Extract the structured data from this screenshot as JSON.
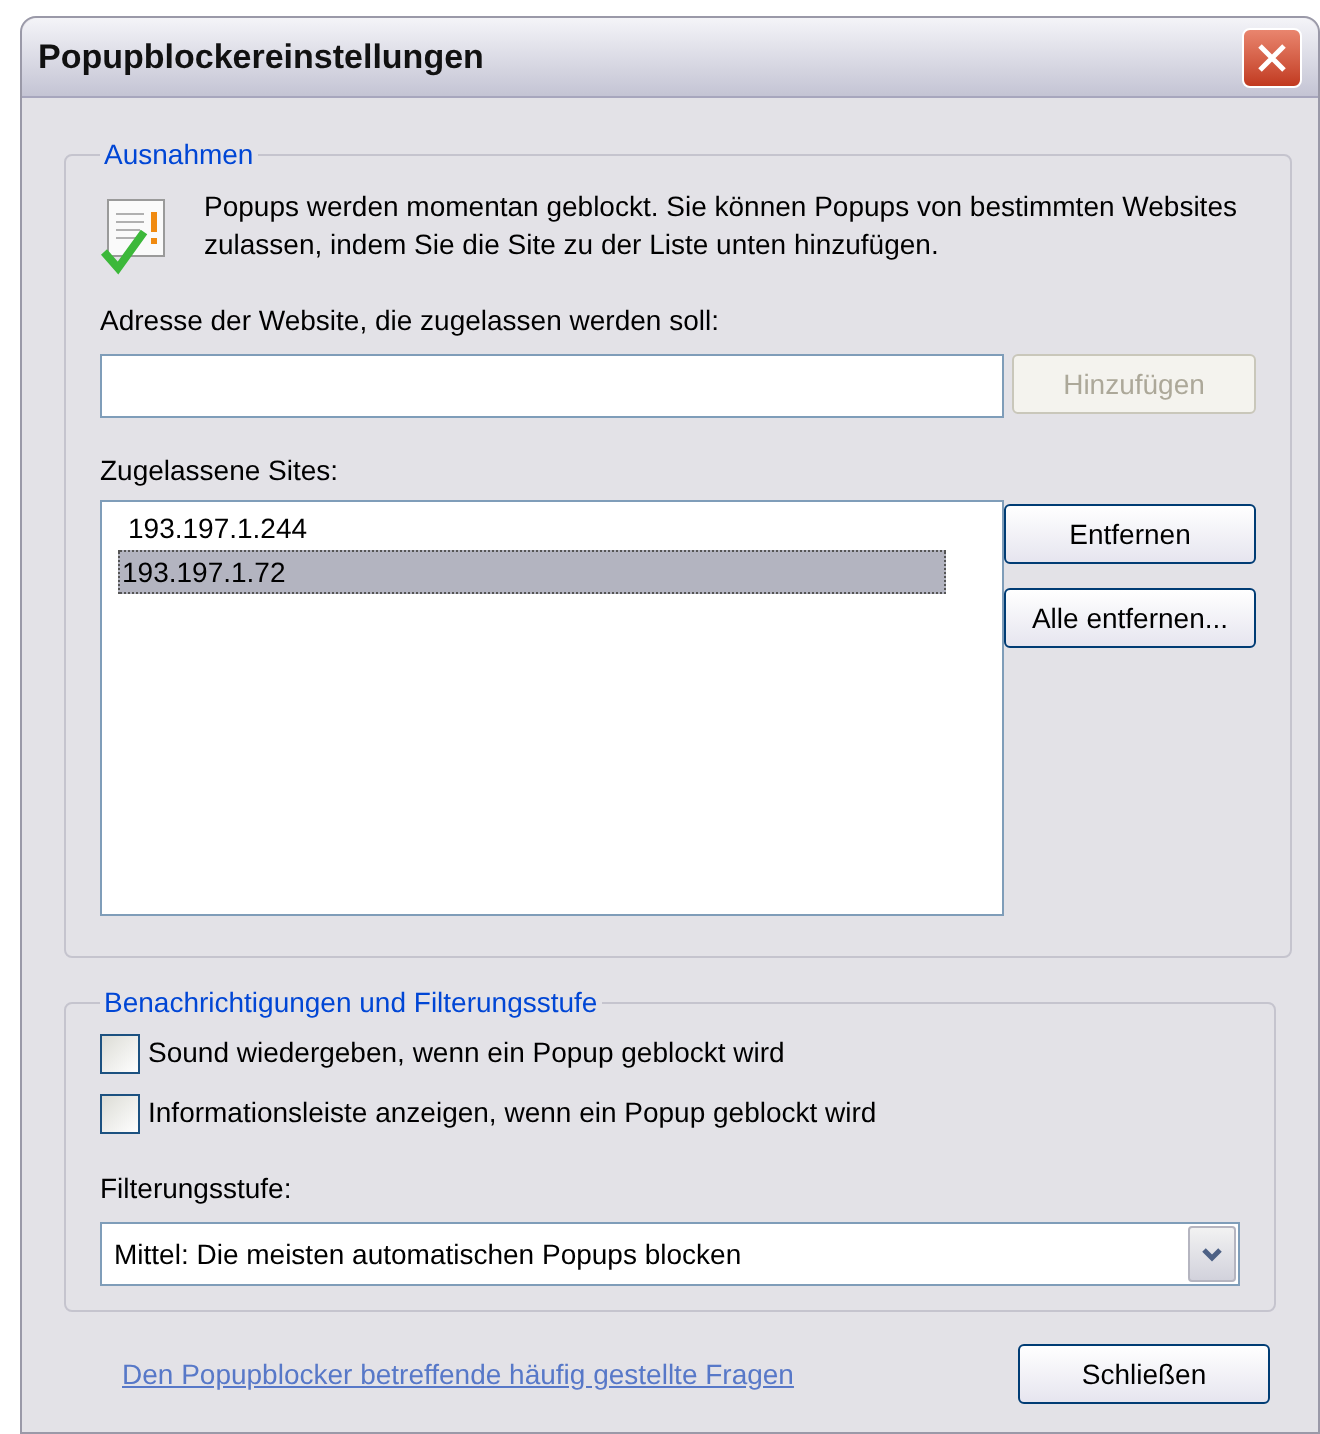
{
  "window": {
    "title": "Popupblockereinstellungen"
  },
  "exceptions": {
    "legend": "Ausnahmen",
    "info": "Popups werden momentan geblockt. Sie können Popups von bestimmten Websites zulassen, indem Sie die Site zu der Liste unten hinzufügen.",
    "address_label": "Adresse der Website, die zugelassen werden soll:",
    "add_button": {
      "label": "Hinzufügen",
      "disabled": true
    },
    "sites_label": "Zugelassene Sites:",
    "sites": [
      {
        "label": "193.197.1.244",
        "selected": false
      },
      {
        "label": "193.197.1.72",
        "selected": true
      }
    ],
    "remove_button": "Entfernen",
    "remove_all_button": "Alle entfernen..."
  },
  "notifications": {
    "legend": "Benachrichtigungen und Filterungsstufe",
    "options": [
      {
        "label": "Sound wiedergeben, wenn ein Popup geblockt wird",
        "checked": false
      },
      {
        "label": "Informationsleiste anzeigen, wenn ein Popup geblockt wird",
        "checked": false
      }
    ],
    "filter_label": "Filterungsstufe:",
    "filter_value": "Mittel: Die meisten automatischen Popups blocken"
  },
  "faq_link": "Den Popupblocker betreffende häufig gestellte Fragen",
  "close_button": "Schließen"
}
